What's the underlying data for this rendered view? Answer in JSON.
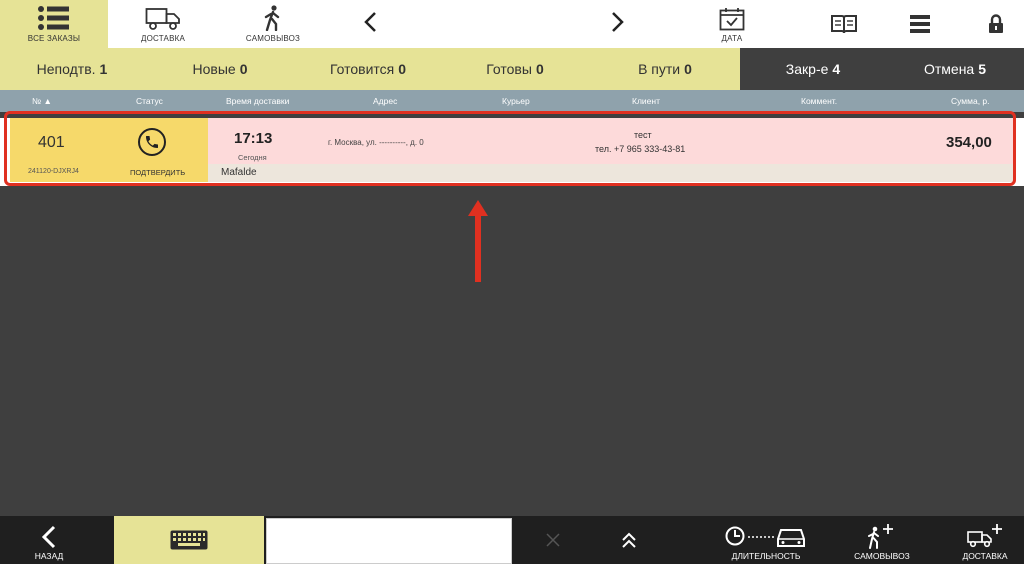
{
  "toolbar": {
    "all_orders": "ВСЕ ЗАКАЗЫ",
    "delivery": "ДОСТАВКА",
    "pickup": "САМОВЫВОЗ",
    "date": "ДАТА"
  },
  "filters": [
    {
      "label": "Неподтв.",
      "count": "1"
    },
    {
      "label": "Новые",
      "count": "0"
    },
    {
      "label": "Готовится",
      "count": "0"
    },
    {
      "label": "Готовы",
      "count": "0"
    },
    {
      "label": "В пути",
      "count": "0"
    },
    {
      "label": "Закр-е",
      "count": "4"
    },
    {
      "label": "Отмена",
      "count": "5"
    }
  ],
  "columns": {
    "num": "№",
    "status": "Статус",
    "time": "Время доставки",
    "address": "Адрес",
    "courier": "Курьер",
    "client": "Клиент",
    "comment": "Коммент.",
    "sum": "Сумма, р."
  },
  "order": {
    "number": "401",
    "code": "241120-DJXRJ4",
    "status_action": "ПОДТВЕРДИТЬ",
    "time": "17:13",
    "day": "Сегодня",
    "address": "г. Москва, ул. ----------, д. 0",
    "client_name": "тест",
    "client_phone": "тел. +7 965 333-43-81",
    "amount": "354,00",
    "courier": "Mafalde"
  },
  "bottom": {
    "back": "НАЗАД",
    "duration": "ДЛИТЕЛЬНОСТЬ",
    "pickup": "САМОВЫВОЗ",
    "delivery": "ДОСТАВКА",
    "search_value": ""
  },
  "colors": {
    "accent_yellow": "#e6e396",
    "order_yellow": "#f6d96a",
    "row_pink": "#fddada",
    "highlight_red": "#e03020",
    "header_blue_gray": "#8fa2ac",
    "dark_bg": "#3f3f3f"
  }
}
